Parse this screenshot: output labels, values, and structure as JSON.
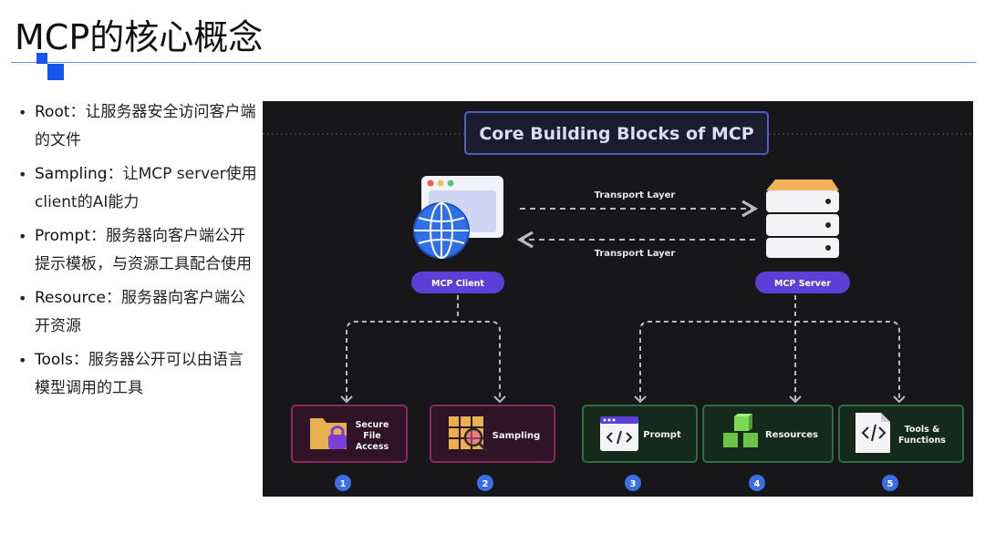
{
  "title": "MCP的核心概念",
  "bullets": [
    {
      "term": "Root",
      "sep": "：",
      "text": "让服务器安全访问客户端的文件"
    },
    {
      "term": "Sampling",
      "sep": "：",
      "text": "让MCP server使用client的AI能力"
    },
    {
      "term": "Prompt",
      "sep": "：",
      "text": "服务器向客户端公开提示模板，与资源工具配合使用"
    },
    {
      "term": "Resource",
      "sep": "：",
      "text": "服务器向客户端公开资源"
    },
    {
      "term": "Tools",
      "sep": "：",
      "text": "服务器公开可以由语言模型调用的工具"
    }
  ],
  "diagram": {
    "heading": "Core Building Blocks of MCP",
    "transport_top": "Transport Layer",
    "transport_bottom": "Transport Layer",
    "client_label": "MCP Client",
    "server_label": "MCP Server",
    "blocks": [
      {
        "lines": [
          "Secure",
          "File",
          "Access"
        ],
        "number": "1"
      },
      {
        "lines": [
          "Sampling"
        ],
        "number": "2"
      },
      {
        "lines": [
          "Prompt"
        ],
        "number": "3"
      },
      {
        "lines": [
          "Resources"
        ],
        "number": "4"
      },
      {
        "lines": [
          "Tools &",
          "Functions"
        ],
        "number": "5"
      }
    ],
    "colors": {
      "background": "#17171a",
      "client_blocks_border": "#8a2a5e",
      "client_blocks_fill": "#2e1426",
      "server_blocks_border": "#2f6b45",
      "server_blocks_fill": "#142a1c",
      "pill": "#5b3fd6",
      "number_badge": "#3b6fe6",
      "heading_border": "#4b5fc7"
    }
  }
}
